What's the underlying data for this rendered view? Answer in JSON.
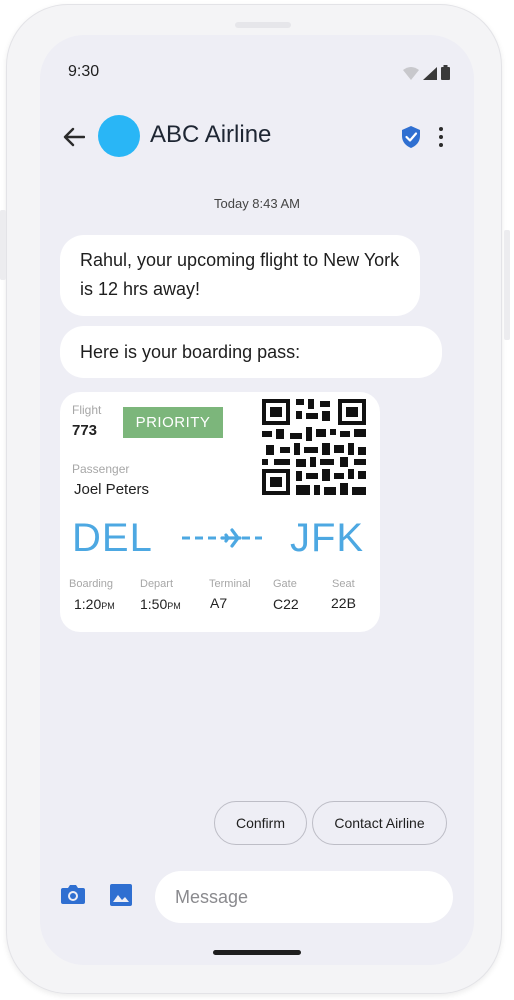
{
  "status_bar": {
    "time": "9:30"
  },
  "header": {
    "contact_name": "ABC Airline"
  },
  "conversation": {
    "timestamp": "Today 8:43 AM",
    "messages": [
      "Rahul, your upcoming flight to New York is 12 hrs away!",
      "Here is your boarding pass:"
    ]
  },
  "boarding_pass": {
    "flight_label": "Flight",
    "flight_number": "773",
    "priority_badge": "PRIORITY",
    "passenger_label": "Passenger",
    "passenger_name": "Joel Peters",
    "origin": "DEL",
    "destination": "JFK",
    "details": [
      {
        "label": "Boarding",
        "time": "1:20",
        "suffix": "PM"
      },
      {
        "label": "Depart",
        "time": "1:50",
        "suffix": "PM"
      },
      {
        "label": "Terminal",
        "value": "A7"
      },
      {
        "label": "Gate",
        "value": "C22"
      },
      {
        "label": "Seat",
        "value": "22B"
      }
    ]
  },
  "suggested_replies": {
    "confirm": "Confirm",
    "contact": "Contact Airline"
  },
  "composer": {
    "placeholder": "Message"
  },
  "colors": {
    "accent": "#29b6f6",
    "iata": "#4da8e2",
    "priority": "#7cb67b",
    "icon_blue": "#2f6fd1"
  },
  "icons": [
    "back-arrow-icon",
    "verified-shield-icon",
    "more-vert-icon",
    "camera-icon",
    "gallery-icon",
    "wifi-icon",
    "signal-icon",
    "battery-icon",
    "plane-icon",
    "qr-code"
  ]
}
